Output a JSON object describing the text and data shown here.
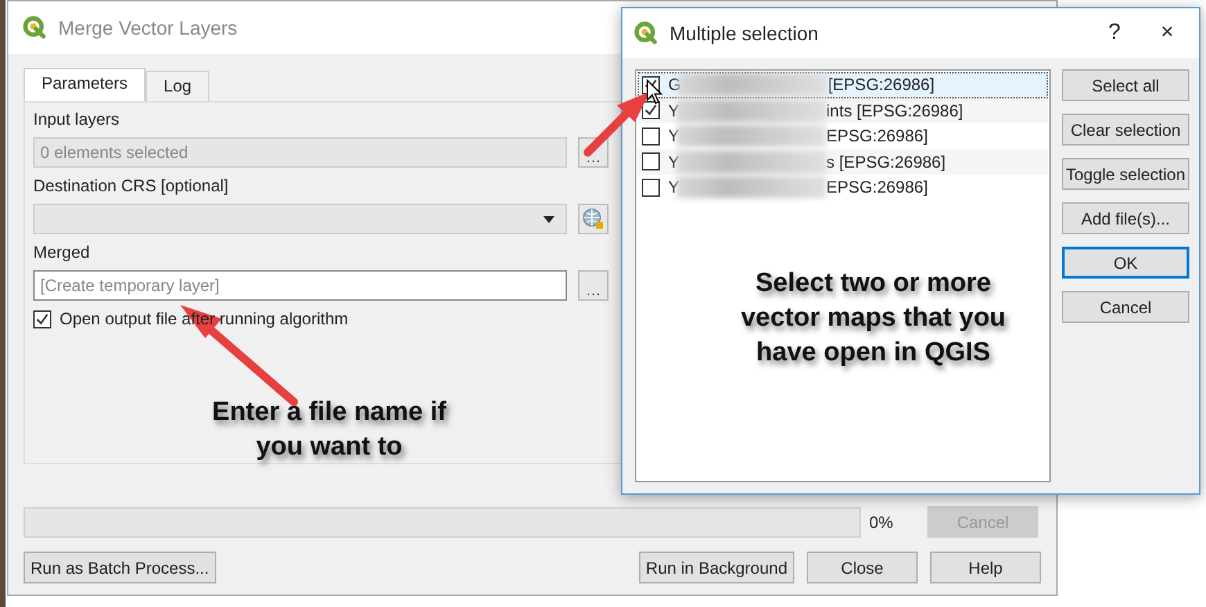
{
  "main_window": {
    "title": "Merge Vector Layers",
    "tabs": [
      {
        "label": "Parameters",
        "selected": true
      },
      {
        "label": "Log",
        "selected": false
      }
    ],
    "input_layers": {
      "label": "Input layers",
      "value": "0 elements selected",
      "button": "…"
    },
    "destination_crs": {
      "label": "Destination CRS [optional]"
    },
    "merged": {
      "label": "Merged",
      "placeholder": "[Create temporary layer]",
      "button": "…"
    },
    "open_output": {
      "label": "Open output file after running algorithm",
      "checked": true
    },
    "progress": {
      "level": 0,
      "reading": "0%"
    },
    "cancel": {
      "label": "Cancel",
      "disabled": true
    },
    "batch_button": {
      "label": "Run as Batch Process...",
      "disabled": false
    },
    "buttons": [
      {
        "label": "Run in Background",
        "disabled": false
      },
      {
        "label": "Close",
        "disabled": false
      },
      {
        "label": "Help",
        "disabled": false
      }
    ]
  },
  "dialog": {
    "title": "Multiple selection",
    "help": "?",
    "close": "×",
    "layers": [
      {
        "prefix": "G",
        "suffix": "[EPSG:26986]",
        "checked": true,
        "selected": true
      },
      {
        "prefix": "Y",
        "suffix": "ints [EPSG:26986]",
        "checked": true,
        "selected": false
      },
      {
        "prefix": "Y",
        "suffix": "EPSG:26986]",
        "checked": false,
        "selected": false
      },
      {
        "prefix": "Y",
        "suffix": "s [EPSG:26986]",
        "checked": false,
        "selected": false
      },
      {
        "prefix": "Y",
        "suffix": "EPSG:26986]",
        "checked": false,
        "selected": false
      }
    ],
    "buttons": [
      {
        "label": "Select all",
        "default": false
      },
      {
        "label": "Clear selection",
        "default": false
      },
      {
        "label": "Toggle selection",
        "default": false
      },
      {
        "label": "Add file(s)...",
        "default": false
      },
      {
        "label": "OK",
        "default": true
      },
      {
        "label": "Cancel",
        "default": false
      }
    ]
  },
  "annotations": [
    {
      "text": "Enter a file name if\nyou want to"
    },
    {
      "text": "Select two or more\nvector maps that you\nhave open in QGIS"
    }
  ]
}
